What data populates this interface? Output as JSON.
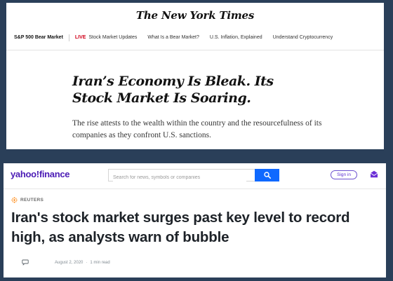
{
  "nyt": {
    "logo": "The New York Times",
    "nav": {
      "primary": "S&P 500 Bear Market",
      "live_badge": "LIVE",
      "links": [
        "Stock Market Updates",
        "What Is a Bear Market?",
        "U.S. Inflation, Explained",
        "Understand Cryptocurrency"
      ]
    },
    "headline": "Iran’s Economy Is Bleak. Its Stock Market Is Soaring.",
    "summary": "The rise attests to the wealth within the country and the resourcefulness of its companies as they confront U.S. sanctions."
  },
  "yahoo": {
    "logo_left": "yahoo",
    "logo_slash": "!",
    "logo_right": "finance",
    "search": {
      "placeholder": "Search for news, symbols or companies",
      "icon": "search-icon"
    },
    "signin_label": "Sign in",
    "mail_icon": "mail-icon",
    "source": "REUTERS",
    "headline": "Iran's stock market surges past key level to record high, as analysts warn of bubble",
    "meta": {
      "date": "August 2, 2020",
      "separator": "·",
      "read_time": "1 min read"
    }
  },
  "colors": {
    "background": "#2a3f59",
    "yahoo_purple": "#4b1bb5",
    "search_blue": "#0f69ff",
    "live_red": "#d0021b"
  }
}
